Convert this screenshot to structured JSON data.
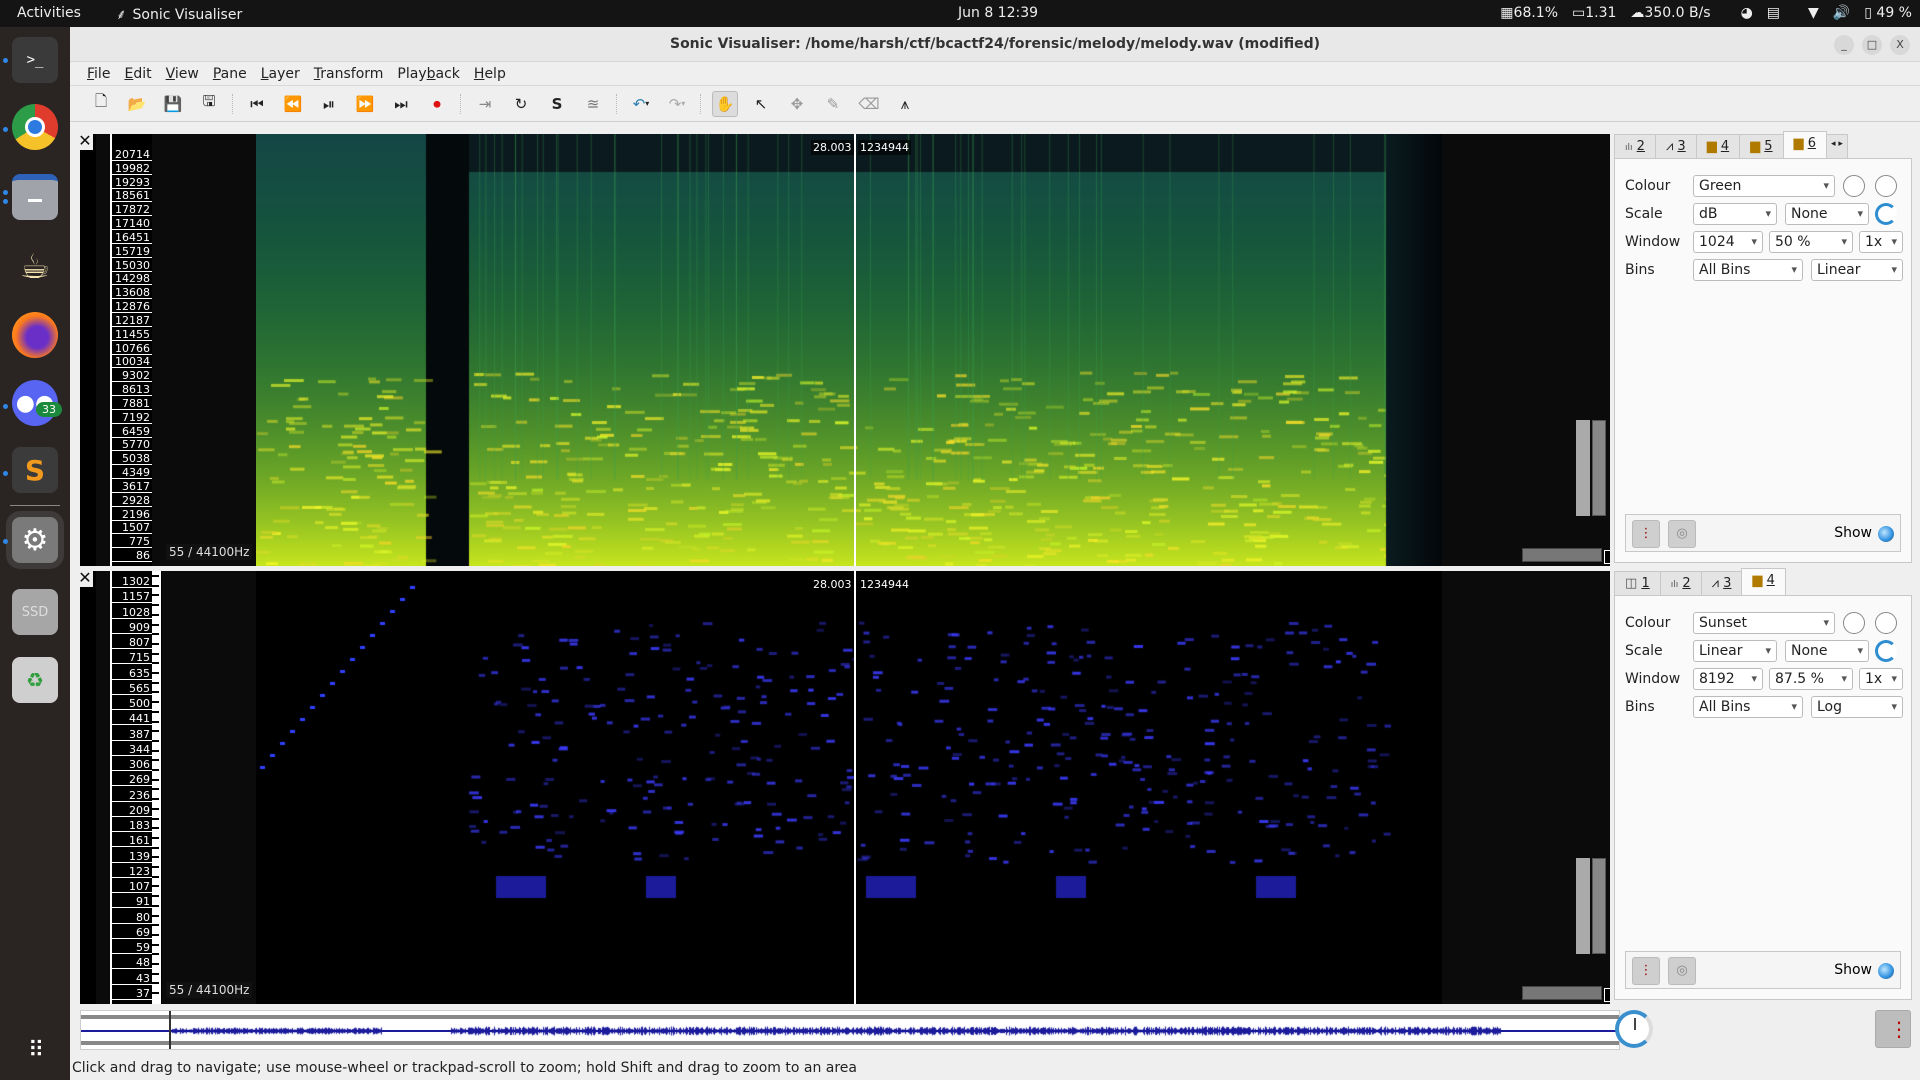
{
  "topbar": {
    "activities": "Activities",
    "app_name": "Sonic Visualiser",
    "clock": "Jun 8  12:39",
    "cpu": "68.1%",
    "load": "1.31",
    "net": "350.0 B/s",
    "battery": "49 %"
  },
  "dock": {
    "items": [
      {
        "name": "terminal",
        "glyph": ">_",
        "running": true
      },
      {
        "name": "chrome",
        "glyph": "◉",
        "running": true
      },
      {
        "name": "files",
        "glyph": "▬",
        "running": true
      },
      {
        "name": "java",
        "glyph": "☕",
        "running": false
      },
      {
        "name": "firefox",
        "glyph": "🦊",
        "running": false
      },
      {
        "name": "discord",
        "glyph": "◕",
        "running": true,
        "badge": "33"
      },
      {
        "name": "sublime-text",
        "glyph": "S",
        "running": true
      },
      {
        "name": "settings",
        "glyph": "⚙",
        "running": true
      },
      {
        "name": "ssd-drive",
        "glyph": "SSD",
        "running": false
      },
      {
        "name": "trash",
        "glyph": "♻",
        "running": false
      }
    ],
    "apps_grid": "⋮⋮⋮"
  },
  "window": {
    "title": "Sonic Visualiser: /home/harsh/ctf/bcactf24/forensic/melody/melody.wav (modified)",
    "minimize": "_",
    "maximize": "□",
    "close": "X"
  },
  "menu": [
    {
      "label": "File",
      "mnemonic": "F",
      "rest": "ile"
    },
    {
      "label": "Edit",
      "mnemonic": "E",
      "rest": "dit"
    },
    {
      "label": "View",
      "mnemonic": "V",
      "rest": "iew"
    },
    {
      "label": "Pane",
      "mnemonic": "P",
      "rest": "ane"
    },
    {
      "label": "Layer",
      "mnemonic": "L",
      "rest": "ayer"
    },
    {
      "label": "Transform",
      "mnemonic": "T",
      "rest": "ransform"
    },
    {
      "label": "Playback",
      "pre": "Play",
      "mnemonic": "b",
      "rest": "ack"
    },
    {
      "label": "Help",
      "mnemonic": "H",
      "rest": "elp"
    }
  ],
  "toolbar": {
    "file_tools": [
      {
        "name": "new-session",
        "glyph": "🗋"
      },
      {
        "name": "open",
        "glyph": "📂"
      },
      {
        "name": "save",
        "glyph": "💾"
      },
      {
        "name": "save-as",
        "glyph": "🖫"
      }
    ],
    "transport": [
      {
        "name": "rewind-start",
        "glyph": "⏮"
      },
      {
        "name": "rewind",
        "glyph": "⏪"
      },
      {
        "name": "play-pause",
        "glyph": "⏯"
      },
      {
        "name": "fast-forward",
        "glyph": "⏩"
      },
      {
        "name": "fast-forward-end",
        "glyph": "⏭"
      },
      {
        "name": "record",
        "glyph": "⏺"
      }
    ],
    "play_modes": [
      {
        "name": "play-selection",
        "glyph": "⇥"
      },
      {
        "name": "loop",
        "glyph": "↻"
      },
      {
        "name": "solo",
        "glyph": "S"
      },
      {
        "name": "align",
        "glyph": "≊"
      }
    ],
    "undo_redo": [
      {
        "name": "undo",
        "glyph": "↶"
      },
      {
        "name": "redo",
        "glyph": "↷"
      }
    ],
    "tools": [
      {
        "name": "navigate",
        "glyph": "✋",
        "active": true
      },
      {
        "name": "select",
        "glyph": "↖",
        "active": false
      },
      {
        "name": "edit",
        "glyph": "✥",
        "active": false
      },
      {
        "name": "draw",
        "glyph": "✎",
        "active": false
      },
      {
        "name": "erase",
        "glyph": "⌫",
        "active": false
      },
      {
        "name": "measure",
        "glyph": "⩚",
        "active": false
      }
    ]
  },
  "panes": [
    {
      "freq_labels": [
        "20714",
        "19982",
        "19293",
        "18561",
        "17872",
        "17140",
        "16451",
        "15719",
        "15030",
        "14298",
        "13608",
        "12876",
        "12187",
        "11455",
        "10766",
        "10034",
        "9302",
        "8613",
        "7881",
        "7192",
        "6459",
        "5770",
        "5038",
        "4349",
        "3617",
        "2928",
        "2196",
        "1507",
        "775",
        "86"
      ],
      "rate_label": "55 / 44100Hz",
      "cursor_time": "28.003",
      "cursor_frame": "1234944",
      "colour_scheme": "green",
      "layer_tabs": [
        {
          "icon": "spectrum",
          "glyph": "ılı",
          "num": "2"
        },
        {
          "icon": "waveform",
          "glyph": "⩘",
          "num": "3"
        },
        {
          "icon": "spectrogram",
          "glyph": "▆",
          "num": "4"
        },
        {
          "icon": "spectrogram",
          "glyph": "▆",
          "num": "5"
        },
        {
          "icon": "spectrogram",
          "glyph": "▆",
          "num": "6",
          "active": true
        }
      ],
      "props": {
        "colour_label": "Colour",
        "colour": "Green",
        "scale_label": "Scale",
        "scale": "dB",
        "normalize": "None",
        "window_label": "Window",
        "window_size": "1024",
        "overlap": "50 %",
        "oversampling": "1x",
        "bins_label": "Bins",
        "bins": "All Bins",
        "bin_scale": "Linear"
      },
      "show_label": "Show"
    },
    {
      "freq_labels": [
        "1302",
        "1157",
        "1028",
        "909",
        "807",
        "715",
        "635",
        "565",
        "500",
        "441",
        "387",
        "344",
        "306",
        "269",
        "236",
        "209",
        "183",
        "161",
        "139",
        "123",
        "107",
        "91",
        "80",
        "69",
        "59",
        "48",
        "43",
        "37"
      ],
      "rate_label": "55 / 44100Hz",
      "cursor_time": "28.003",
      "cursor_frame": "1234944",
      "colour_scheme": "sunset",
      "layer_tabs": [
        {
          "icon": "time-ruler",
          "glyph": "◫",
          "num": "1"
        },
        {
          "icon": "spectrum",
          "glyph": "ılı",
          "num": "2"
        },
        {
          "icon": "waveform",
          "glyph": "⩘",
          "num": "3"
        },
        {
          "icon": "spectrogram",
          "glyph": "▆",
          "num": "4",
          "active": true
        }
      ],
      "props": {
        "colour_label": "Colour",
        "colour": "Sunset",
        "scale_label": "Scale",
        "scale": "Linear",
        "normalize": "None",
        "window_label": "Window",
        "window_size": "8192",
        "overlap": "87.5 %",
        "oversampling": "1x",
        "bins_label": "Bins",
        "bins": "All Bins",
        "bin_scale": "Log"
      },
      "show_label": "Show"
    }
  ],
  "status": "Click and drag to navigate; use mouse-wheel or trackpad-scroll to zoom; hold Shift and drag to zoom to an area",
  "colors": {
    "accent": "#2d8dd0",
    "waveform": "#1b1b9c"
  }
}
